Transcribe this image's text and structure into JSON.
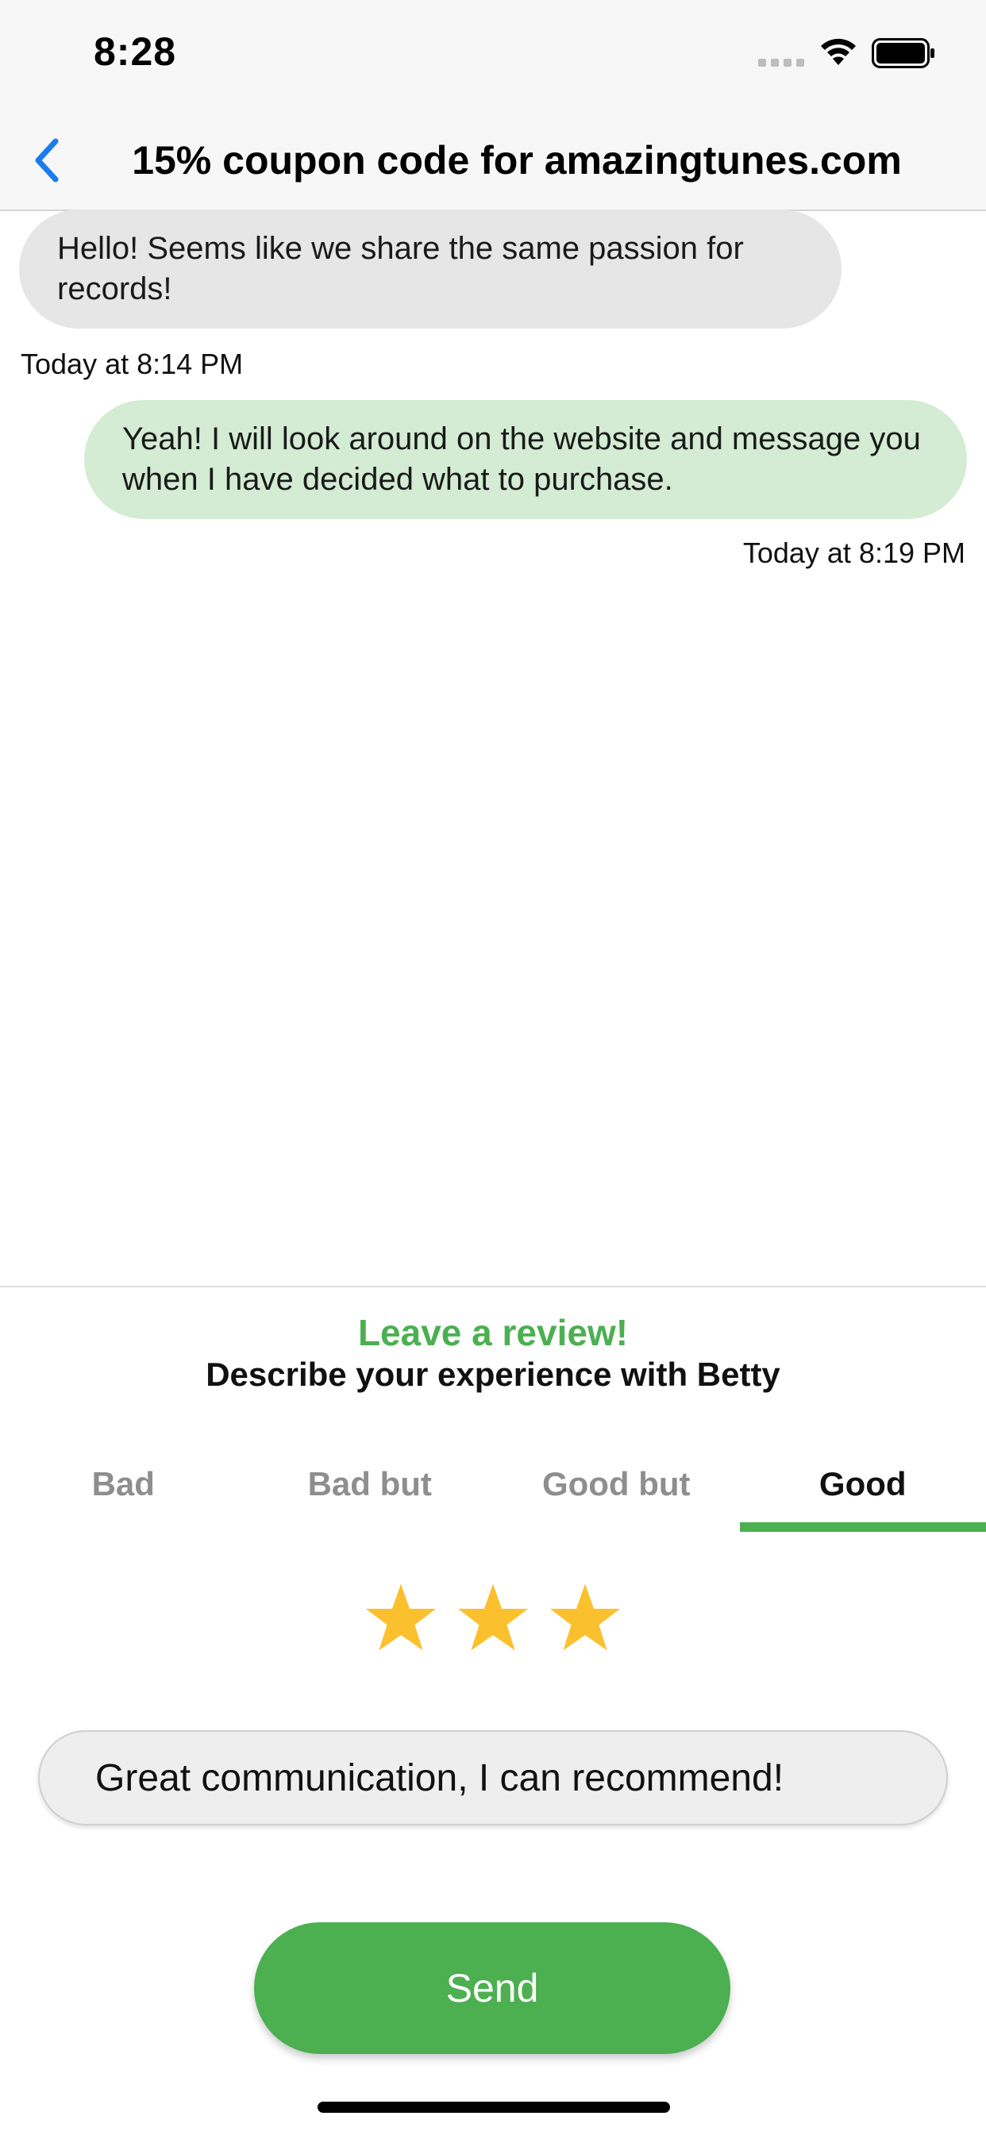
{
  "status_bar": {
    "time": "8:28",
    "icons": [
      "signal-icon",
      "wifi-icon",
      "battery-icon"
    ]
  },
  "nav": {
    "back_icon": "chevron-left-icon",
    "title": "15% coupon code for amazingtunes.com"
  },
  "messages": [
    {
      "direction": "incoming",
      "text": "Hello! Seems like we share the same passion for records!",
      "timestamp": "Today at 8:14 PM"
    },
    {
      "direction": "outgoing",
      "text": "Yeah! I will look around on the website and message you when I have decided what to purchase.",
      "timestamp": "Today at 8:19 PM"
    }
  ],
  "review": {
    "title": "Leave a review!",
    "subtitle": "Describe your experience with Betty",
    "tabs": [
      {
        "label": "Bad"
      },
      {
        "label": "Bad but"
      },
      {
        "label": "Good but"
      },
      {
        "label": "Good"
      }
    ],
    "selected_tab": "Good",
    "rating": 3,
    "comment_value": "Great communication, I can recommend!",
    "send_label": "Send"
  },
  "colors": {
    "accent": "#4caf50",
    "back_link": "#1a7cf0",
    "incoming_bubble": "#e6e6e6",
    "outgoing_bubble": "#d3ecd3",
    "star": "#fbc02d"
  }
}
